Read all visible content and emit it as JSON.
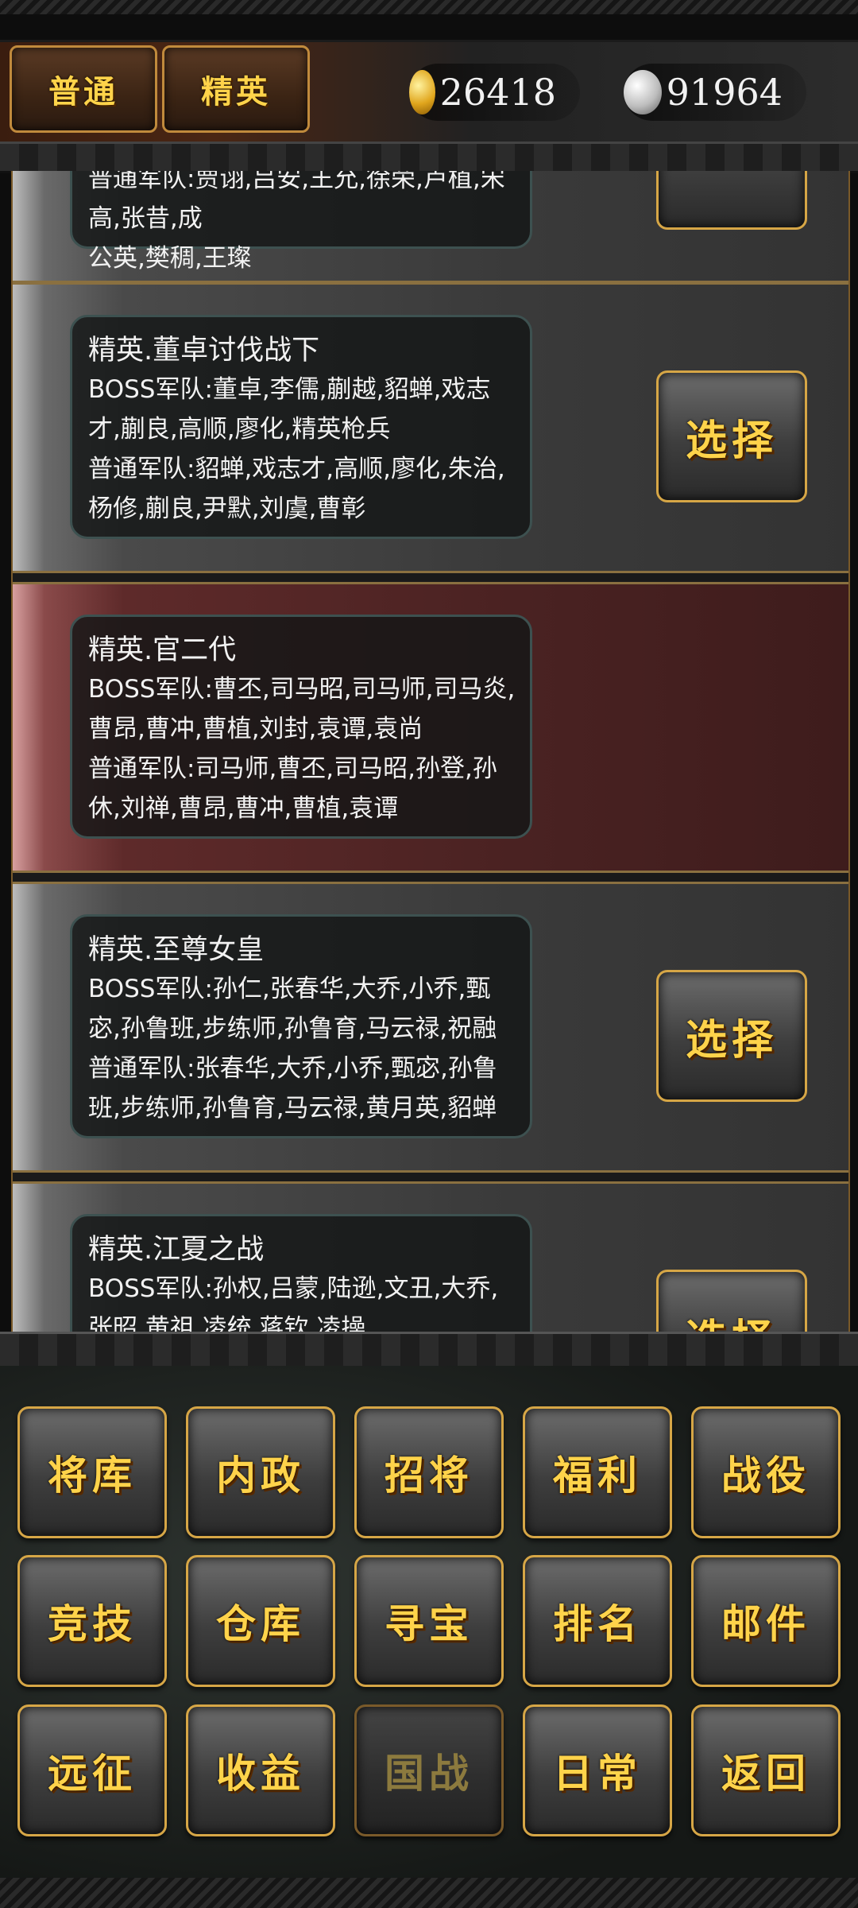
{
  "header": {
    "tabs": [
      {
        "label": "普通"
      },
      {
        "label": "精英"
      }
    ],
    "gold": {
      "icon": "gold-ingot-icon",
      "amount": "26418"
    },
    "silver": {
      "icon": "silver-ingot-icon",
      "amount": "91964"
    }
  },
  "list": {
    "partial_top_card": {
      "line_a": "普通军队:贾诩,吕安,王允,徐荣,卢植,宋高,张昔,成",
      "line_b": "公英,樊稠,王璨"
    },
    "cards": [
      {
        "title": "精英.董卓讨伐战下",
        "boss": "BOSS军队:董卓,李儒,蒯越,貂蝉,戏志才,蒯良,高顺,廖化,精英枪兵",
        "normal": "普通军队:貂蝉,戏志才,高顺,廖化,朱治,杨修,蒯良,尹默,刘虞,曹彰",
        "button": "选择"
      },
      {
        "title": "精英.官二代",
        "boss": "BOSS军队:曹丕,司马昭,司马师,司马炎,曹昂,曹冲,曹植,刘封,袁谭,袁尚",
        "normal": "普通军队:司马师,曹丕,司马昭,孙登,孙休,刘禅,曹昂,曹冲,曹植,袁谭",
        "button": ""
      },
      {
        "title": "精英.至尊女皇",
        "boss": "BOSS军队:孙仁,张春华,大乔,小乔,甄宓,孙鲁班,步练师,孙鲁育,马云禄,祝融",
        "normal": "普通军队:张春华,大乔,小乔,甄宓,孙鲁班,步练师,孙鲁育,马云禄,黄月英,貂蝉",
        "button": "选择"
      },
      {
        "title": "精英.江夏之战",
        "boss": "BOSS军队:孙权,吕蒙,陆逊,文丑,大乔,张昭,黄祖,凌统,蒋钦,凌操",
        "normal": "",
        "button": "选择"
      }
    ]
  },
  "menu": {
    "items": [
      "将库",
      "内政",
      "招将",
      "福利",
      "战役",
      "竞技",
      "仓库",
      "寻宝",
      "排名",
      "邮件",
      "远征",
      "收益",
      "国战",
      "日常",
      "返回"
    ]
  },
  "colors": {
    "gold_text": "#ffd34a",
    "button_border": "#d6a646",
    "selected_card": "#5e2a2a"
  }
}
